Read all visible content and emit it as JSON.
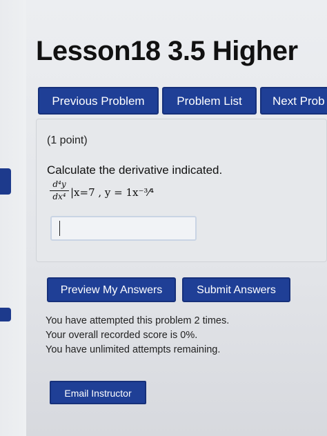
{
  "header": {
    "title": "Lesson18 3.5 Higher"
  },
  "nav": {
    "previous": "Previous Problem",
    "list": "Problem List",
    "next": "Next Prob"
  },
  "problem": {
    "points": "(1 point)",
    "prompt": "Calculate the derivative indicated.",
    "deriv_num": "d⁴y",
    "deriv_den": "dx⁴",
    "evaluation": "|x=7 , y = 1x⁻³⁄⁴",
    "answer_value": ""
  },
  "actions": {
    "preview": "Preview My Answers",
    "submit": "Submit Answers"
  },
  "status": {
    "attempted": "You have attempted this problem 2 times.",
    "score": "Your overall recorded score is 0%.",
    "remaining": "You have unlimited attempts remaining."
  },
  "footer": {
    "email": "Email Instructor"
  },
  "colors": {
    "button": "#1f3f96",
    "button_border": "#16307a"
  }
}
